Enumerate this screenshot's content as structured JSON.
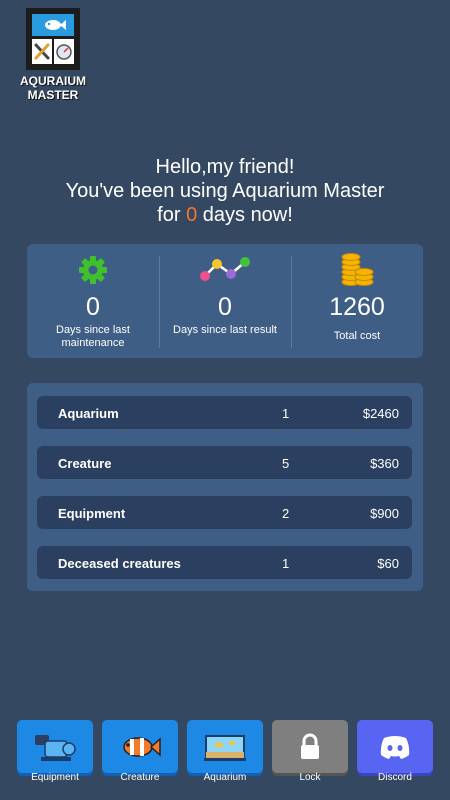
{
  "app": {
    "logo_line1": "AQURAIUM",
    "logo_line2": "MASTER"
  },
  "greeting": {
    "line1": "Hello,my friend!",
    "line2": "You've been using Aquarium Master",
    "line3_prefix": "for ",
    "days": "0",
    "line3_suffix": " days now!"
  },
  "stats": [
    {
      "icon": "gear-icon",
      "value": "0",
      "label": "Days since last maintenance"
    },
    {
      "icon": "line-graph-icon",
      "value": "0",
      "label": "Days since last result"
    },
    {
      "icon": "coins-icon",
      "value": "1260",
      "label": "Total cost"
    }
  ],
  "summary": [
    {
      "name": "Aquarium",
      "count": "1",
      "amount": "$2460"
    },
    {
      "name": "Creature",
      "count": "5",
      "amount": "$360"
    },
    {
      "name": "Equipment",
      "count": "2",
      "amount": "$900"
    },
    {
      "name": "Deceased creatures",
      "count": "1",
      "amount": "$60"
    }
  ],
  "nav": [
    {
      "label": "Equipment",
      "icon": "pump-icon"
    },
    {
      "label": "Creature",
      "icon": "clownfish-icon"
    },
    {
      "label": "Aquarium",
      "icon": "fish-tank-icon"
    },
    {
      "label": "Lock",
      "icon": "lock-icon"
    },
    {
      "label": "Discord",
      "icon": "discord-icon"
    }
  ],
  "colors": {
    "background": "#344862",
    "card": "#3f5e86",
    "row": "#2b3f60",
    "accent_days": "#f4772a",
    "nav_blue": "#1e88e5",
    "nav_gray": "#7f7f7f",
    "nav_discord": "#5865f2"
  }
}
